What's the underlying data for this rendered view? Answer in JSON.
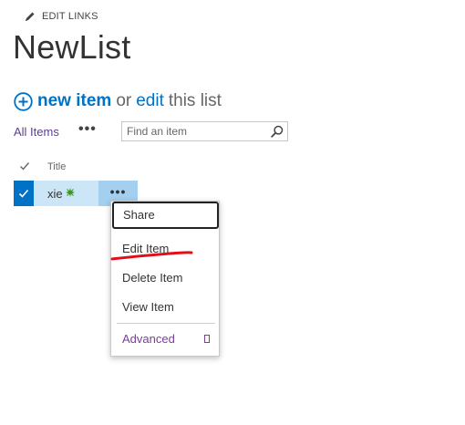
{
  "header": {
    "edit_links_label": "EDIT LINKS",
    "page_title": "NewList"
  },
  "command_line": {
    "new_item_label": "new item",
    "or_label": "or",
    "edit_label": "edit",
    "this_list_label": "this list"
  },
  "view": {
    "current_view": "All Items",
    "more_label": "•••",
    "search_placeholder": "Find an item",
    "search_value": ""
  },
  "list": {
    "columns": [
      "Title"
    ],
    "rows": [
      {
        "title": "xie",
        "is_new": true,
        "selected": true
      }
    ],
    "row_menu_label": "•••"
  },
  "context_menu": {
    "items": [
      {
        "label": "Share",
        "focused": true
      },
      {
        "label": "Edit Item",
        "annotated": true
      },
      {
        "label": "Delete Item"
      },
      {
        "label": "View Item"
      }
    ],
    "advanced_label": "Advanced"
  },
  "colors": {
    "link_blue": "#0072c6",
    "view_purple": "#5b3f8c",
    "selected_row": "#cde6f7",
    "check_blue": "#0072c6",
    "ellipsis_cell": "#a4cfee",
    "advanced_purple": "#7b3c9c",
    "annotation_red": "#e0101a",
    "new_badge_green": "#3a9a1f"
  },
  "icons": {
    "edit_links": "pencil-icon",
    "new_item": "plus-circle-icon",
    "search": "magnifier-icon",
    "header_select": "checkmark-icon",
    "row_select": "checkmark-icon",
    "new_badge": "new-star-icon",
    "advanced": "expand-icon"
  }
}
